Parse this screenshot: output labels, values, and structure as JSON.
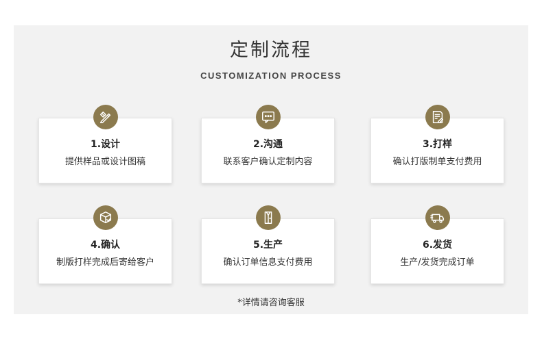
{
  "header": {
    "title": "定制流程",
    "subtitle": "CUSTOMIZATION PROCESS"
  },
  "colors": {
    "accent": "#8b7a4e",
    "panel_bg": "#f2f2f2",
    "card_bg": "#ffffff"
  },
  "steps": [
    {
      "title": "1.设计",
      "desc": "提供样品或设计图稿",
      "icon": "pencil-ruler-icon"
    },
    {
      "title": "2.沟通",
      "desc": "联系客户确认定制内容",
      "icon": "chat-bubble-icon"
    },
    {
      "title": "3.打样",
      "desc": "确认打版制单支付费用",
      "icon": "document-pen-icon"
    },
    {
      "title": "4.确认",
      "desc": "制版打样完成后寄给客户",
      "icon": "box-check-icon"
    },
    {
      "title": "5.生产",
      "desc": "确认订单信息支付费用",
      "icon": "shirt-icon"
    },
    {
      "title": "6.发货",
      "desc": "生产/发货完成订单",
      "icon": "delivery-truck-icon"
    }
  ],
  "footer": {
    "note": "*详情请咨询客服"
  }
}
